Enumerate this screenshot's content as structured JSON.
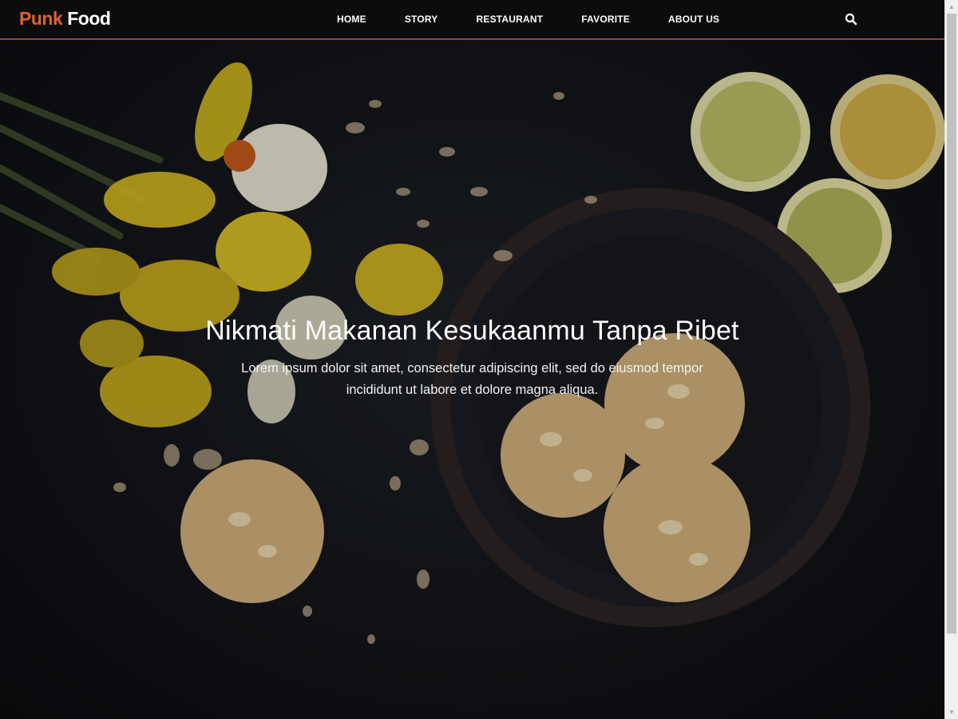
{
  "brand": {
    "part1": "Punk",
    "part2": "Food"
  },
  "nav": {
    "items": [
      {
        "label": "HOME"
      },
      {
        "label": "STORY"
      },
      {
        "label": "RESTAURANT"
      },
      {
        "label": "FAVORITE"
      },
      {
        "label": "ABOUT US"
      }
    ]
  },
  "icons": {
    "search": "search-icon"
  },
  "hero": {
    "title": "Nikmati Makanan Kesukaanmu Tanpa Ribet",
    "subtitle": "Lorem ipsum dolor sit amet, consectetur adipiscing elit, sed do eiusmod tempor incididunt ut labore et dolore magna aliqua."
  },
  "colors": {
    "brand_accent": "#e3612f",
    "navbar_bg": "#0c0c0d",
    "nav_border": "#8a4a2c"
  }
}
